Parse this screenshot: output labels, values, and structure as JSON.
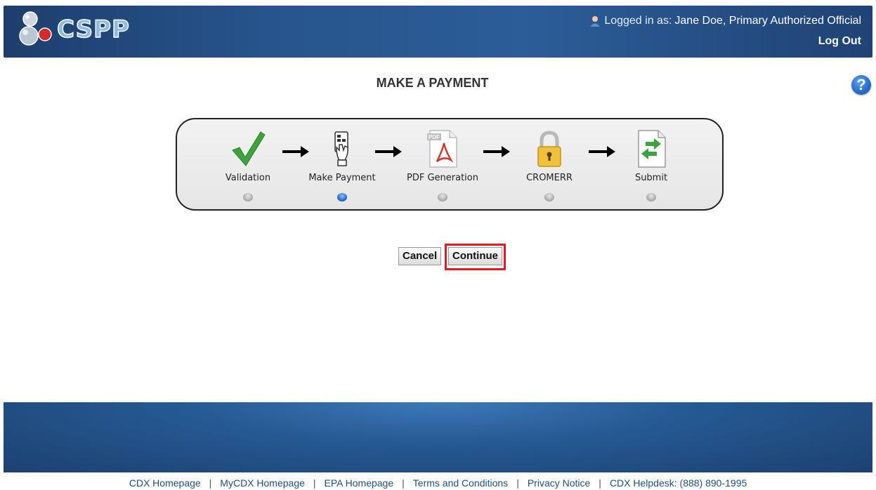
{
  "header": {
    "logo_text": "CSPP",
    "logged_in_prefix": "Logged in as:",
    "user": "Jane Doe, Primary Authorized Official",
    "logout_label": "Log Out"
  },
  "main": {
    "title": "MAKE A PAYMENT",
    "help_label": "?",
    "steps": [
      {
        "label": "Validation",
        "icon": "checkmark-icon",
        "active": false
      },
      {
        "label": "Make Payment",
        "icon": "payment-card-icon",
        "active": true
      },
      {
        "label": "PDF Generation",
        "icon": "pdf-icon",
        "active": false
      },
      {
        "label": "CROMERR",
        "icon": "lock-icon",
        "active": false
      },
      {
        "label": "Submit",
        "icon": "submit-document-icon",
        "active": false
      }
    ],
    "cancel_label": "Cancel",
    "continue_label": "Continue"
  },
  "footer": {
    "links": [
      "CDX Homepage",
      "MyCDX Homepage",
      "EPA Homepage",
      "Terms and Conditions",
      "Privacy Notice",
      "CDX Helpdesk: (888) 890-1995"
    ]
  },
  "colors": {
    "header_blue": "#27548c",
    "highlight_red": "#e11b22",
    "active_dot": "#2563c4",
    "link_blue": "#1f4f86"
  }
}
